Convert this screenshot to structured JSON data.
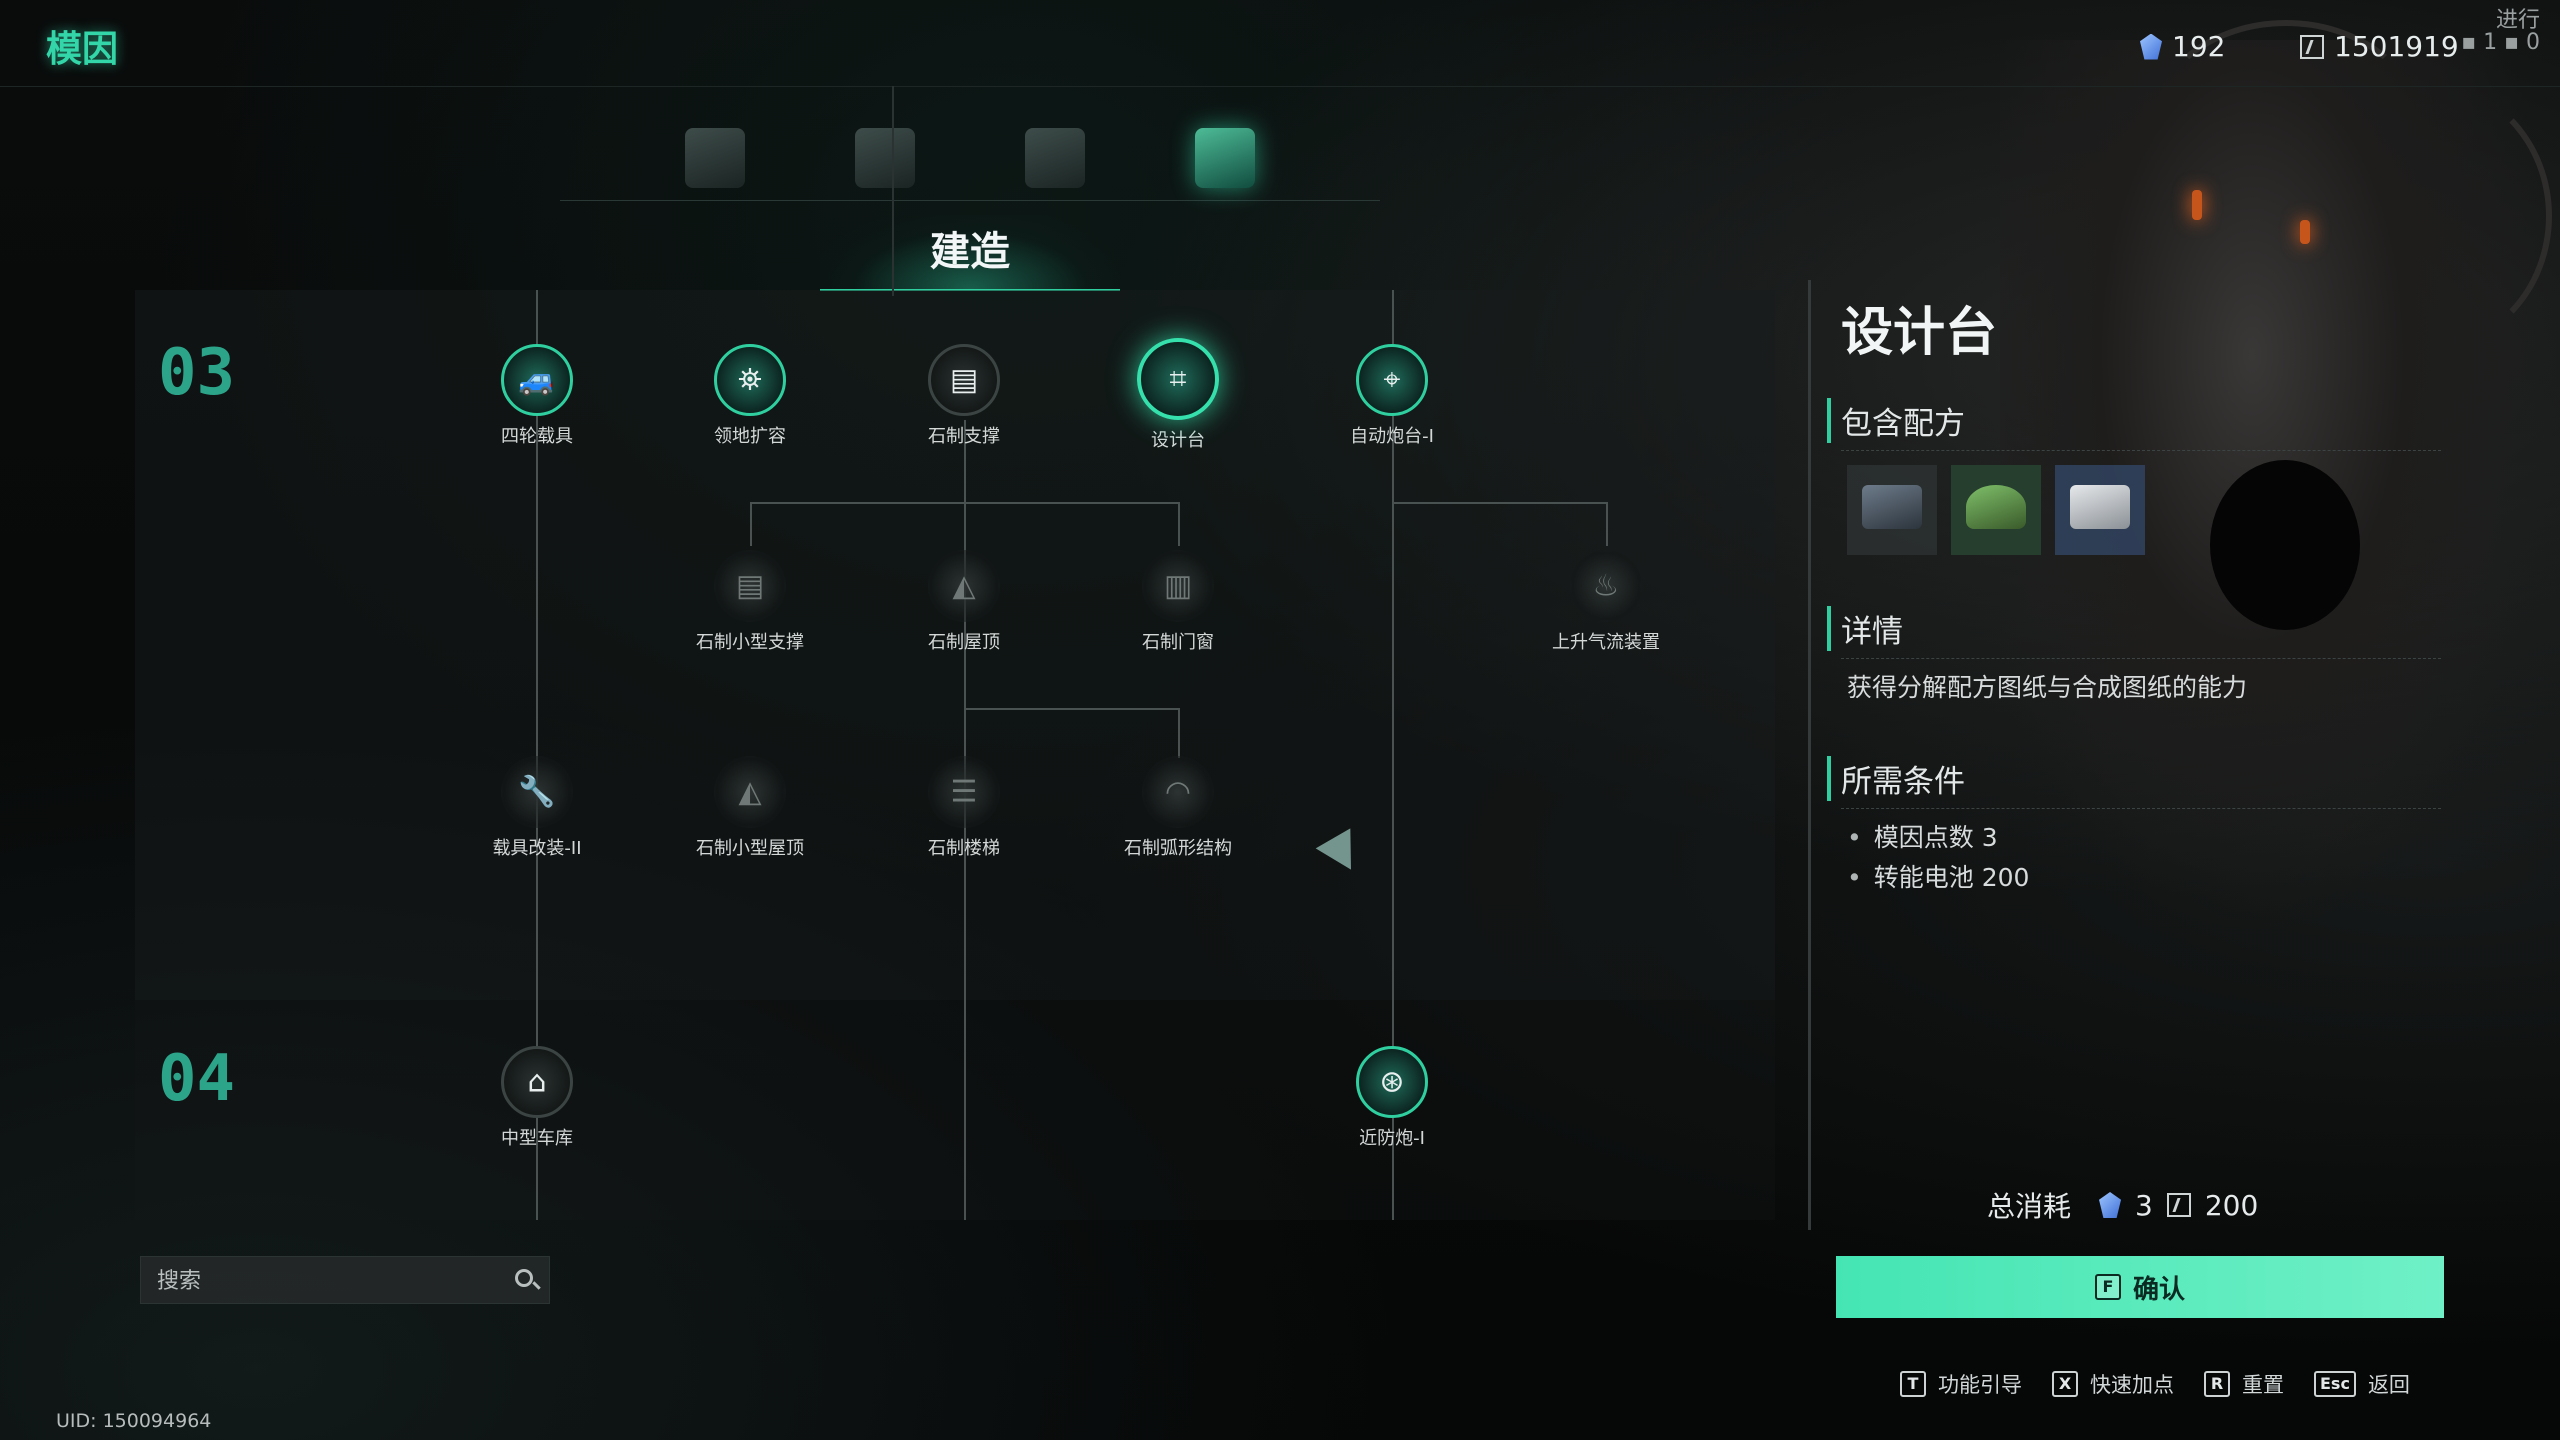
{
  "app": {
    "title": "模因"
  },
  "resources": {
    "gene_points": "192",
    "battery": "1501919"
  },
  "status_text": "进行",
  "categories": [
    {
      "name": "weapon",
      "icon": "mosquito-drone-icon"
    },
    {
      "name": "workbench",
      "icon": "workbench-icon"
    },
    {
      "name": "planting",
      "icon": "plant-icon"
    },
    {
      "name": "building",
      "icon": "building-icon",
      "active": true
    }
  ],
  "section": {
    "title": "建造"
  },
  "tiers": {
    "t1": "03",
    "t2": "04"
  },
  "nodes": {
    "four_wheel": "四轮载具",
    "territory": "领地扩容",
    "stone_support": "石制支撑",
    "design_table": "设计台",
    "auto_turret": "自动炮台-I",
    "stone_small_support": "石制小型支撑",
    "stone_roof": "石制屋顶",
    "stone_doorwindow": "石制门窗",
    "updraft": "上升气流装置",
    "vehicle_mod": "载具改装-II",
    "stone_small_roof": "石制小型屋顶",
    "stone_stairs": "石制楼梯",
    "stone_arc": "石制弧形结构",
    "medium_garage": "中型车库",
    "ciws": "近防炮-I"
  },
  "search": {
    "placeholder": "搜索"
  },
  "uid": "UID: 150094964",
  "panel": {
    "title": "设计台",
    "recipes_header": "包含配方",
    "details_header": "详情",
    "detail_text": "获得分解配方图纸与合成图纸的能力",
    "requirements_header": "所需条件",
    "requirements": [
      "模因点数 3",
      "转能电池 200"
    ],
    "total_cost_label": "总消耗",
    "cost_points": "3",
    "cost_battery": "200"
  },
  "confirm": {
    "key": "F",
    "label": "确认"
  },
  "hints": [
    {
      "key": "T",
      "label": "功能引导"
    },
    {
      "key": "X",
      "label": "快速加点"
    },
    {
      "key": "R",
      "label": "重置"
    },
    {
      "key": "Esc",
      "label": "返回"
    }
  ],
  "colors": {
    "accent": "#33d6a8",
    "confirm": "#5fedbf",
    "tier": "#2ba48a"
  }
}
